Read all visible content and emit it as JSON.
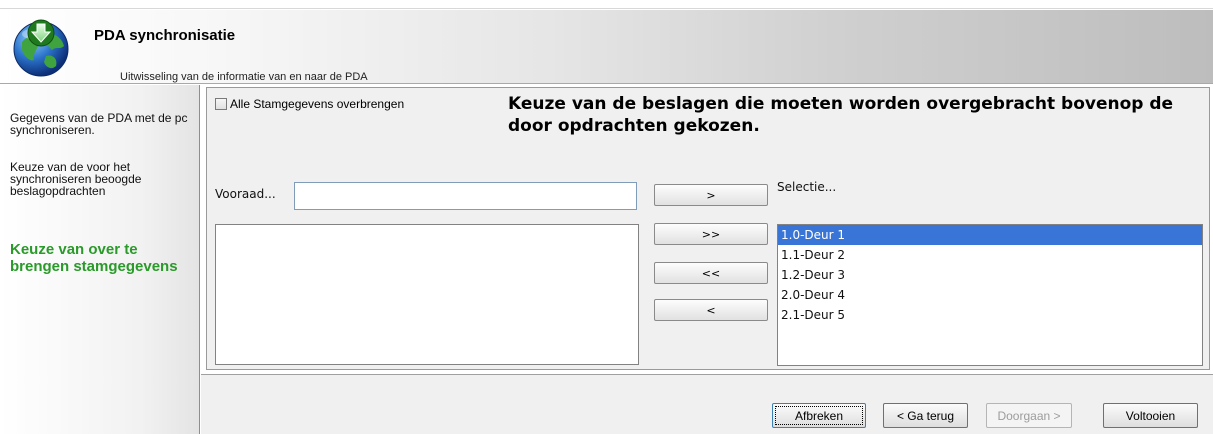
{
  "header": {
    "title": "PDA synchronisatie",
    "subtitle": "Uitwisseling van de informatie van en naar de PDA",
    "icon": "globe-download-icon"
  },
  "sidebar": {
    "items": [
      {
        "label": "Gegevens van de PDA met de pc synchroniseren.",
        "active": false
      },
      {
        "label": "Keuze van de voor het synchroniseren beoogde beslagopdrachten",
        "active": false
      },
      {
        "label": "Keuze van over te brengen stamgegevens",
        "active": true
      }
    ],
    "active_color": "#2a9a2a"
  },
  "main": {
    "checkbox_label": "Alle Stamgegevens overbrengen",
    "checkbox_checked": false,
    "heading": "Keuze van de beslagen die moeten worden overgebracht bovenop de door opdrachten gekozen.",
    "stock_label": "Vooraad...",
    "stock_input_value": "",
    "selection_label": "Selectie...",
    "buttons": {
      "add_one": ">",
      "add_all": ">>",
      "remove_all": "<<",
      "remove_one": "<"
    },
    "stock_items": [],
    "selected_items": [
      "1.0-Deur 1",
      "1.1-Deur 2",
      "1.2-Deur 3",
      "2.0-Deur 4",
      "2.1-Deur 5"
    ],
    "highlighted_index": 0,
    "highlight_color": "#3875d7"
  },
  "footer": {
    "cancel": "Afbreken",
    "back": "< Ga terug",
    "next": "Doorgaan >",
    "finish": "Voltooien"
  }
}
